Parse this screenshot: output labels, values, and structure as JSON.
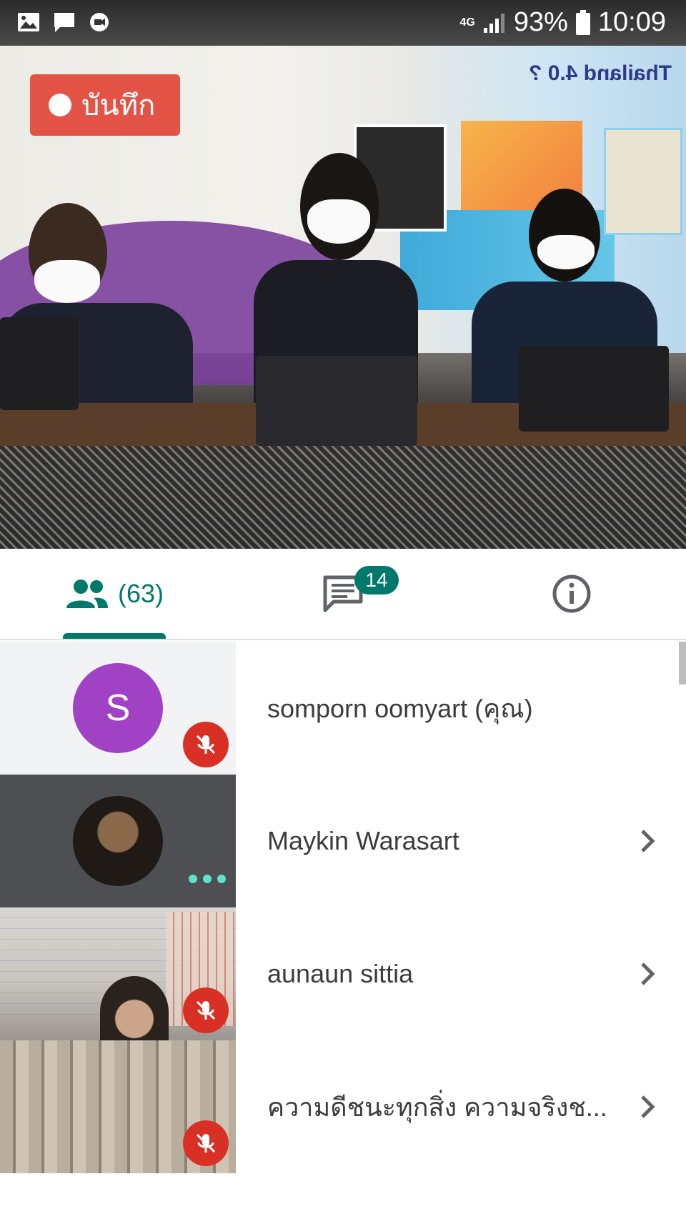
{
  "status_bar": {
    "network": "4G",
    "battery": "93%",
    "time": "10:09"
  },
  "video": {
    "recording_label": "บันทึก",
    "banner_text": "Thailand 4.0 ?"
  },
  "tabs": {
    "people_count": "(63)",
    "chat_badge": "14"
  },
  "participants": [
    {
      "name": "somporn oomyart (คุณ)",
      "avatar_letter": "S",
      "muted": true
    },
    {
      "name": "Maykin Warasart",
      "speaking": true
    },
    {
      "name": "aunaun sittia",
      "muted": true
    },
    {
      "name": "ความดีชนะทุกสิ่ง ความจริงช...",
      "muted": true
    }
  ],
  "colors": {
    "accent": "#00796b",
    "record": "#e35447",
    "mute": "#d93025",
    "avatar_s": "#a142c4"
  }
}
